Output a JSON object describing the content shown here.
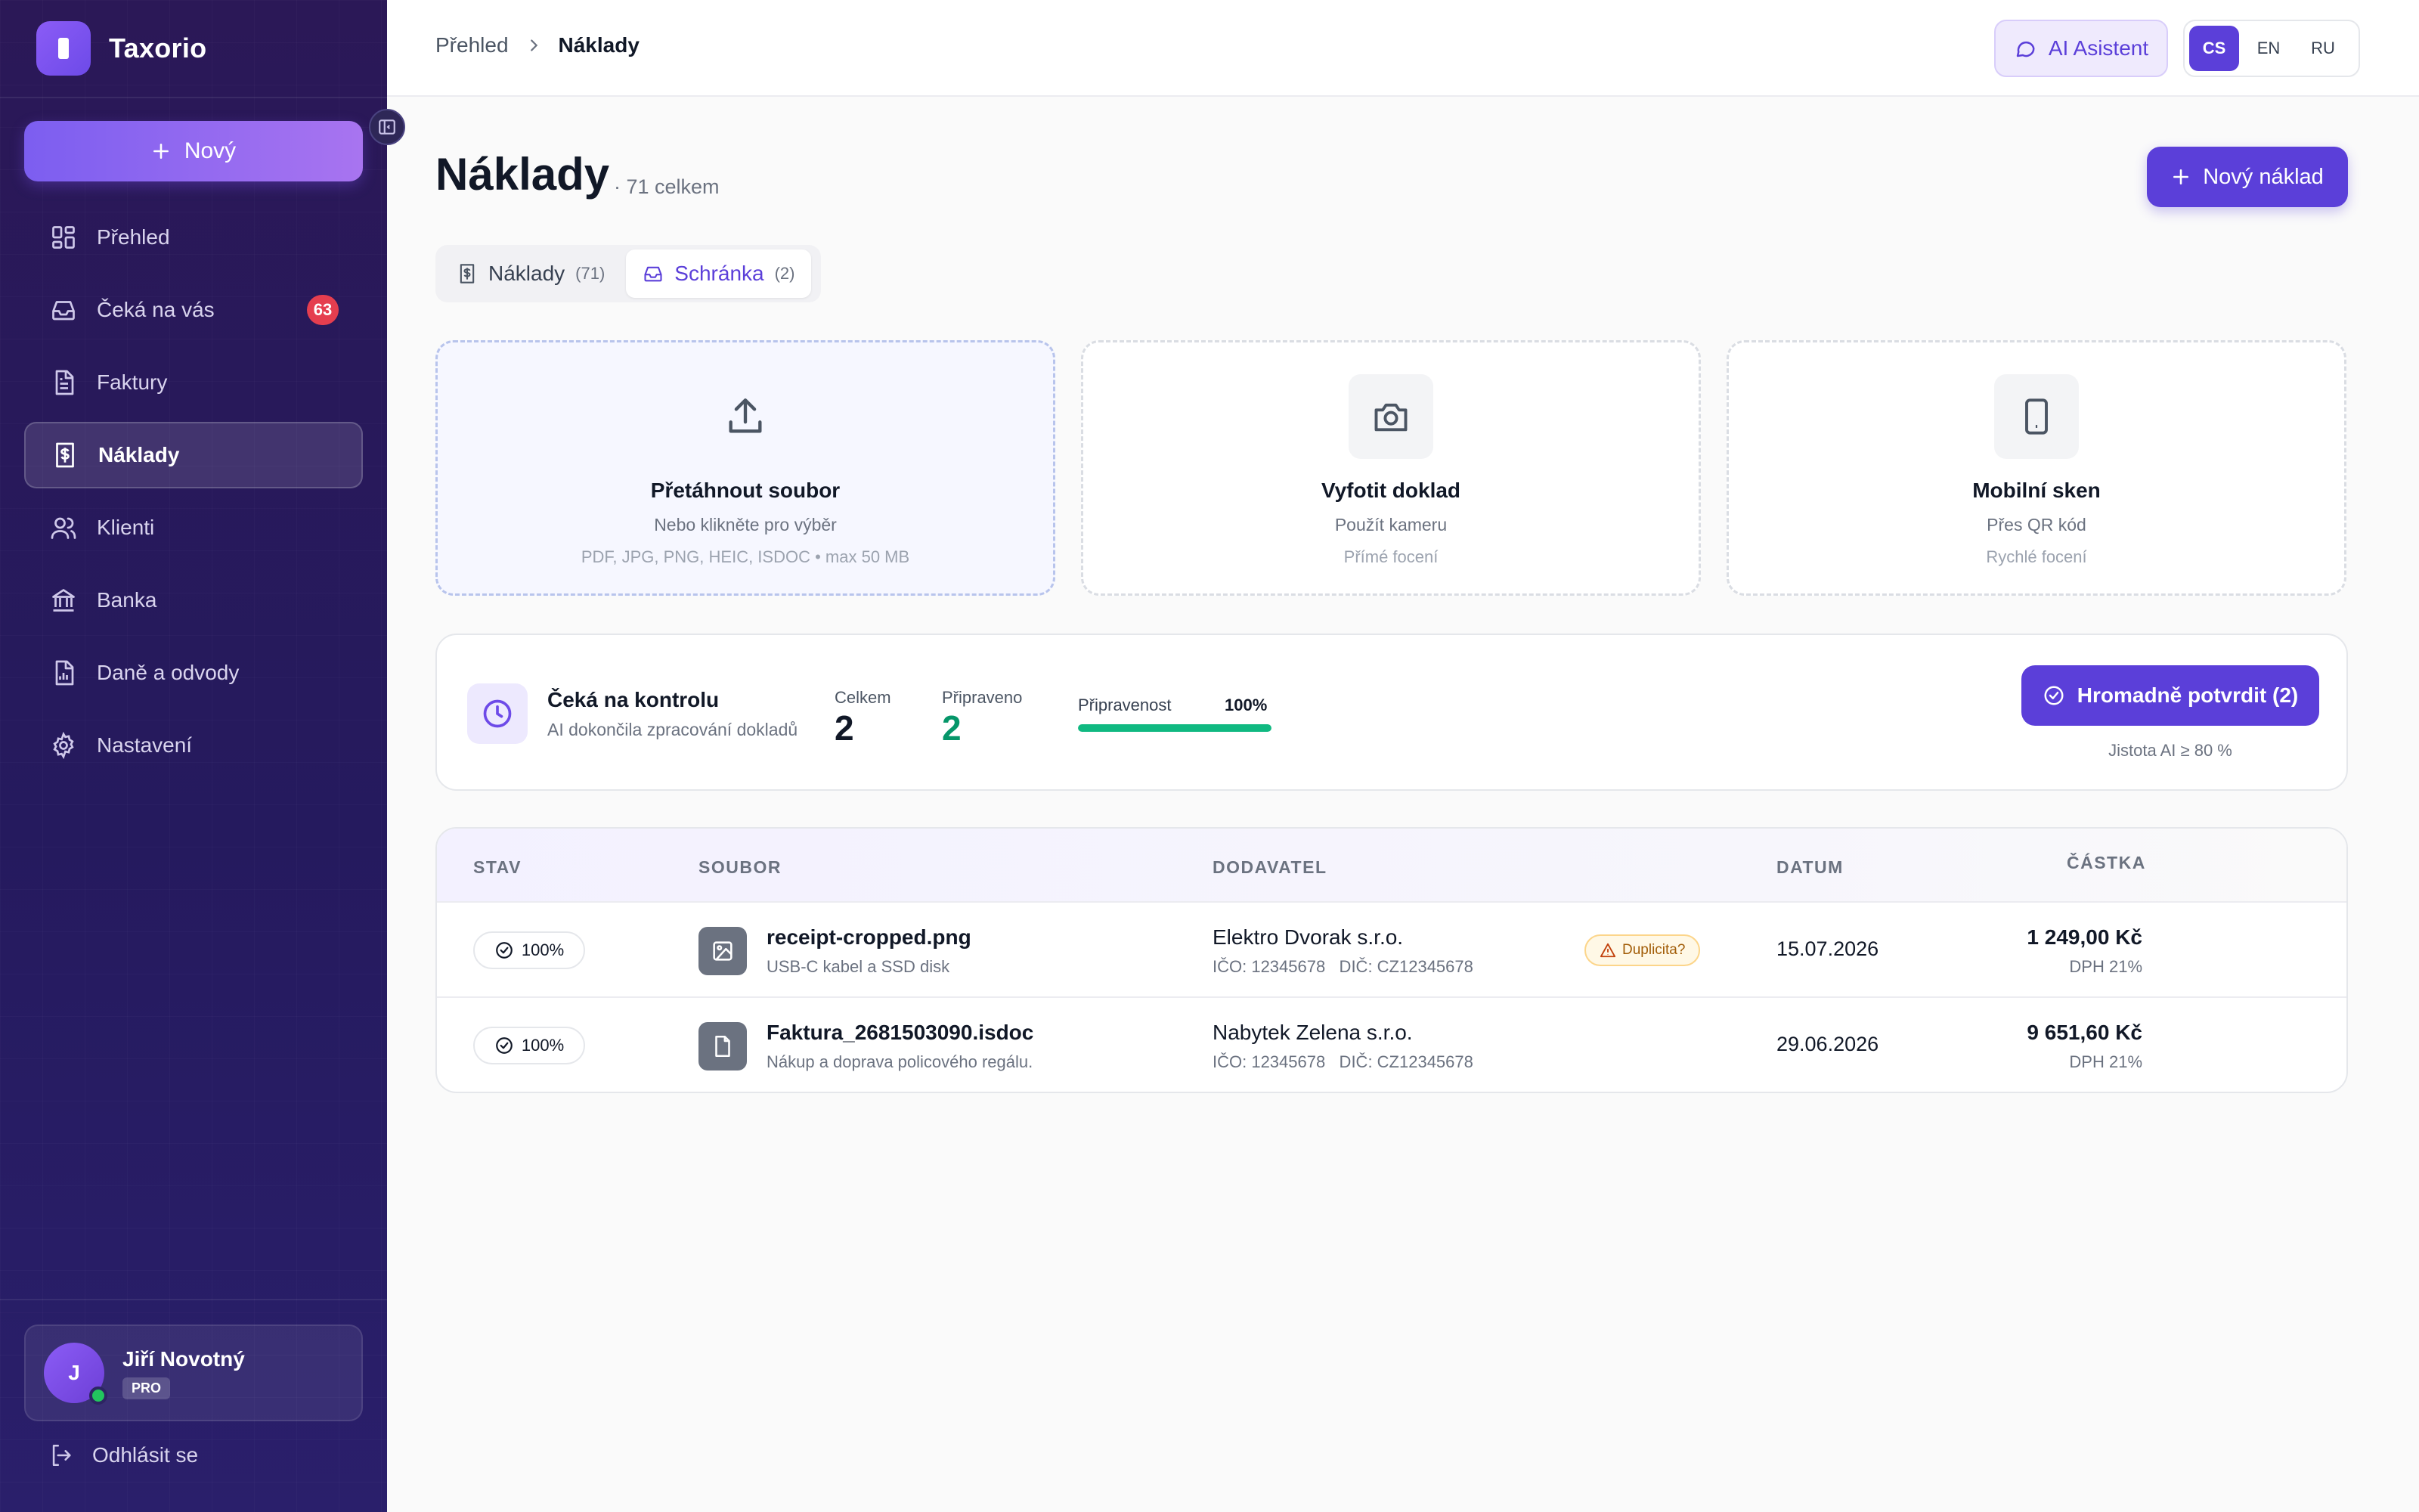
{
  "app": {
    "name": "Taxorio"
  },
  "sidebar": {
    "new_label": "Nový",
    "items": [
      {
        "label": "Přehled",
        "icon": "dashboard-icon"
      },
      {
        "label": "Čeká na vás",
        "icon": "inbox-icon",
        "badge": "63"
      },
      {
        "label": "Faktury",
        "icon": "document-icon"
      },
      {
        "label": "Náklady",
        "icon": "receipt-icon",
        "active": true
      },
      {
        "label": "Klienti",
        "icon": "users-icon"
      },
      {
        "label": "Banka",
        "icon": "bank-icon"
      },
      {
        "label": "Daně a odvody",
        "icon": "report-icon"
      },
      {
        "label": "Nastavení",
        "icon": "gear-icon"
      }
    ],
    "user": {
      "initial": "J",
      "name": "Jiří Novotný",
      "plan": "PRO"
    },
    "logout_label": "Odhlásit se"
  },
  "topbar": {
    "breadcrumb": [
      "Přehled",
      "Náklady"
    ],
    "ai_label": "AI Asistent",
    "languages": [
      "CS",
      "EN",
      "RU"
    ],
    "active_language": "CS"
  },
  "main": {
    "title": "Náklady",
    "count_text": "· 71 celkem",
    "new_expense_label": "Nový náklad",
    "tabs": [
      {
        "label": "Náklady",
        "count": "(71)"
      },
      {
        "label": "Schránka",
        "count": "(2)",
        "active": true
      }
    ],
    "upload_cards": [
      {
        "title": "Přetáhnout soubor",
        "subtitle": "Nebo klikněte pro výběr",
        "hint": "PDF, JPG, PNG, HEIC, ISDOC • max 50 MB",
        "icon": "upload-icon"
      },
      {
        "title": "Vyfotit doklad",
        "subtitle": "Použít kameru",
        "hint": "Přímé focení",
        "icon": "camera-icon"
      },
      {
        "title": "Mobilní sken",
        "subtitle": "Přes QR kód",
        "hint": "Rychlé focení",
        "icon": "phone-icon"
      }
    ],
    "review": {
      "title": "Čeká na kontrolu",
      "subtitle": "AI dokončila zpracování dokladů",
      "total_label": "Celkem",
      "total_value": "2",
      "ready_label": "Připraveno",
      "ready_value": "2",
      "readiness_label": "Připravenost",
      "readiness_pct": "100%",
      "readiness_fraction": 1.0,
      "bulk_label": "Hromadně potvrdit (2)",
      "bulk_hint": "Jistota AI ≥ 80 %"
    },
    "table": {
      "columns": [
        "STAV",
        "SOUBOR",
        "DODAVATEL",
        "DATUM",
        "ČÁSTKA"
      ],
      "rows": [
        {
          "status": "100%",
          "file_type": "image-icon",
          "file_name": "receipt-cropped.png",
          "file_desc": "USB-C kabel a SSD disk",
          "vendor": "Elektro Dvorak s.r.o.",
          "vendor_ids": "IČO: 12345678   DIČ: CZ12345678",
          "warning": "Duplicita?",
          "date": "15.07.2026",
          "amount": "1 249,00 Kč",
          "vat": "DPH 21%"
        },
        {
          "status": "100%",
          "file_type": "file-icon",
          "file_name": "Faktura_2681503090.isdoc",
          "file_desc": "Nákup a doprava policového regálu.",
          "vendor": "Nabytek Zelena s.r.o.",
          "vendor_ids": "IČO: 12345678   DIČ: CZ12345678",
          "warning": "",
          "date": "29.06.2026",
          "amount": "9 651,60 Kč",
          "vat": "DPH 21%"
        }
      ]
    }
  },
  "colors": {
    "accent": "#5b3fd9",
    "sidebar_bg": "#2b1857",
    "badge_red": "#e53e4f",
    "success_green": "#10b981",
    "warning_amber": "#a15c07"
  }
}
